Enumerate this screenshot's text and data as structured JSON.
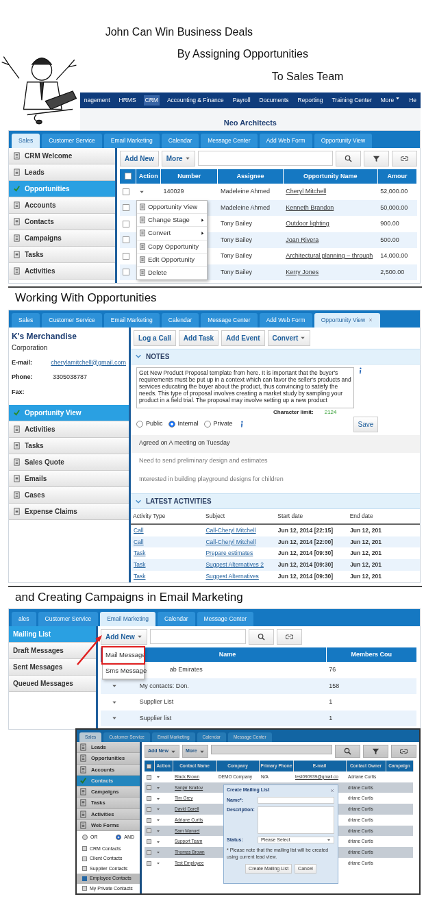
{
  "headlines": [
    "John Can Win Business Deals",
    "By Assigning Opportunities",
    "To Sales Team"
  ],
  "opportunities_screen": {
    "top_menu": [
      {
        "label": "nagement",
        "selected": false,
        "dropdown": false
      },
      {
        "label": "HRMS",
        "selected": false,
        "dropdown": false
      },
      {
        "label": "CRM",
        "selected": true,
        "dropdown": false
      },
      {
        "label": "Accounting & Finance",
        "selected": false,
        "dropdown": false
      },
      {
        "label": "Payroll",
        "selected": false,
        "dropdown": false
      },
      {
        "label": "Documents",
        "selected": false,
        "dropdown": false
      },
      {
        "label": "Reporting",
        "selected": false,
        "dropdown": false
      },
      {
        "label": "Training Center",
        "selected": false,
        "dropdown": false
      },
      {
        "label": "More",
        "selected": false,
        "dropdown": true
      },
      {
        "label": "He",
        "selected": false,
        "dropdown": false
      }
    ],
    "company": "Neo Architects",
    "tabs": [
      {
        "label": "Sales",
        "selected": true
      },
      {
        "label": "Customer Service",
        "selected": false
      },
      {
        "label": "Email Marketing",
        "selected": false
      },
      {
        "label": "Calendar",
        "selected": false
      },
      {
        "label": "Message Center",
        "selected": false
      },
      {
        "label": "Add Web Form",
        "selected": false
      },
      {
        "label": "Opportunity View",
        "selected": false
      }
    ],
    "sidebar": [
      {
        "label": "CRM Welcome",
        "selected": false
      },
      {
        "label": "Leads",
        "selected": false
      },
      {
        "label": "Opportunities",
        "selected": true
      },
      {
        "label": "Accounts",
        "selected": false
      },
      {
        "label": "Contacts",
        "selected": false
      },
      {
        "label": "Campaigns",
        "selected": false
      },
      {
        "label": "Tasks",
        "selected": false
      },
      {
        "label": "Activities",
        "selected": false
      }
    ],
    "toolbar": [
      "Add New",
      "More"
    ],
    "select_all_checked": false,
    "columns": [
      "Action",
      "Number",
      "Assignee",
      "Opportunity Name",
      "Amour"
    ],
    "rows": [
      {
        "checked": false,
        "number": "140029",
        "assignee": "Madeleine Ahmed",
        "opportunity": "Cheryl Mitchell",
        "amount": "52,000.00"
      },
      {
        "checked": false,
        "assignee": "Madeleine Ahmed",
        "opportunity": "Kenneth Brandon",
        "amount": "50,000.00"
      },
      {
        "checked": false,
        "assignee": "Tony Bailey",
        "opportunity": "Outdoor lighting",
        "amount": "900.00"
      },
      {
        "checked": false,
        "assignee": "Tony Bailey",
        "opportunity": "Joan Rivera",
        "amount": "500.00"
      },
      {
        "checked": false,
        "assignee": "Tony Bailey",
        "opportunity": "Architectural planning – through",
        "amount": "14,000.00"
      },
      {
        "checked": false,
        "assignee": "Tony Bailey",
        "opportunity": "Kerry Jones",
        "amount": "2,500.00"
      }
    ],
    "context_menu": [
      {
        "label": "Opportunity View",
        "submenu": false
      },
      {
        "label": "Change Stage",
        "submenu": true
      },
      {
        "label": "Convert",
        "submenu": true
      },
      {
        "label": "Copy Opportunity",
        "submenu": false
      },
      {
        "label": "Edit Opportunity",
        "submenu": false
      },
      {
        "label": "Delete",
        "submenu": false
      }
    ]
  },
  "section_title_2": "Working With Opportunities",
  "opportunity_view": {
    "tabs": [
      {
        "label": "Sales",
        "selected": false
      },
      {
        "label": "Customer Service",
        "selected": false
      },
      {
        "label": "Email Marketing",
        "selected": false
      },
      {
        "label": "Calendar",
        "selected": false
      },
      {
        "label": "Message Center",
        "selected": false
      },
      {
        "label": "Add Web Form",
        "selected": false
      },
      {
        "label": "Opportunity View",
        "selected": true,
        "closable": true
      }
    ],
    "account": {
      "name": "K's Merchandise",
      "type": "Corporation",
      "fields": [
        {
          "label": "E-mail:",
          "value": "cherylamitchell@gmail.com",
          "kind": "link"
        },
        {
          "label": "Phone:",
          "value": "3305038787",
          "kind": "text"
        },
        {
          "label": "Fax:"
        }
      ]
    },
    "sidebar": [
      {
        "label": "Opportunity View",
        "selected": true
      },
      {
        "label": "Activities",
        "selected": false
      },
      {
        "label": "Tasks",
        "selected": false
      },
      {
        "label": "Sales Quote",
        "selected": false
      },
      {
        "label": "Emails",
        "selected": false
      },
      {
        "label": "Cases",
        "selected": false
      },
      {
        "label": "Expense Claims",
        "selected": false
      }
    ],
    "actions": [
      {
        "label": "Log a Call",
        "dropdown": false
      },
      {
        "label": "Add Task",
        "dropdown": false
      },
      {
        "label": "Add Event",
        "dropdown": false
      },
      {
        "label": "Convert",
        "dropdown": true
      }
    ],
    "notes": {
      "title": "NOTES",
      "text": "Get New Product Proposal template from here. It is important that the buyer's requirements must be put up in a context which can favor the seller's products and services educating the buyer about the product, thus convincing to satisfy the needs. This type of proposal involves creating a market study by sampling your product in a field trial. The proposal may involve setting up a new product",
      "char_limit_label": "Character limit:",
      "char_limit": "2124",
      "visibility": [
        {
          "label": "Public",
          "selected": false
        },
        {
          "label": "Internal",
          "selected": true
        },
        {
          "label": "Private",
          "selected": false
        }
      ],
      "save": "Save",
      "entries": [
        "Agreed on A meeting on Tuesday",
        "Need to send preliminary design and estimates",
        "Interested in building playground designs for children"
      ]
    },
    "activities": {
      "title": "LATEST ACTIVITIES",
      "columns": [
        "Activity Type",
        "Subject",
        "Start date",
        "End date"
      ],
      "rows": [
        [
          "Call",
          "Call-Cheryl Mitchell",
          "Jun 12, 2014 [22:15]",
          "Jun 12, 201"
        ],
        [
          "Call",
          "Call-Cheryl Mitchell",
          "Jun 12, 2014 [22:00]",
          "Jun 12, 201"
        ],
        [
          "Task",
          "Prepare estimates",
          "Jun 12, 2014 [09:30]",
          "Jun 12, 201"
        ],
        [
          "Task",
          "Suggest Alternatives 2",
          "Jun 12, 2014 [09:30]",
          "Jun 12, 201"
        ],
        [
          "Task",
          "Suggest Alternatives",
          "Jun 12, 2014 [09:30]",
          "Jun 12, 201"
        ]
      ]
    }
  },
  "section_title_3": "and Creating Campaigns in Email Marketing",
  "email_marketing": {
    "tabs": [
      {
        "label": "ales",
        "selected": false
      },
      {
        "label": "Customer Service",
        "selected": false
      },
      {
        "label": "Email Marketing",
        "selected": true
      },
      {
        "label": "Calendar",
        "selected": false
      },
      {
        "label": "Message Center",
        "selected": false
      }
    ],
    "sidebar": [
      {
        "label": "Mailing List",
        "selected": true
      },
      {
        "label": "Draft Messages",
        "selected": false
      },
      {
        "label": "Sent Messages",
        "selected": false
      },
      {
        "label": "Queued Messages",
        "selected": false
      }
    ],
    "add_new": "Add New",
    "add_menu": [
      {
        "label": "Mail Message",
        "highlighted": true
      },
      {
        "label": "Sms Message",
        "highlighted": false
      }
    ],
    "columns": [
      "Name",
      "Members Cou"
    ],
    "rows": [
      {
        "name": "ab Emirates",
        "count": "76"
      },
      {
        "name": "My contacts: Don.",
        "count": "158"
      },
      {
        "name": "Supplier List",
        "count": "1"
      },
      {
        "name": "Supplier list",
        "count": "1"
      }
    ]
  },
  "contacts_screen": {
    "tabs": [
      {
        "label": "Sales",
        "selected": true
      },
      {
        "label": "Customer Service",
        "selected": false
      },
      {
        "label": "Email Marketing",
        "selected": false
      },
      {
        "label": "Calendar",
        "selected": false
      },
      {
        "label": "Message Center",
        "selected": false
      }
    ],
    "sidebar": [
      {
        "label": "Leads",
        "selected": false
      },
      {
        "label": "Opportunities",
        "selected": false
      },
      {
        "label": "Accounts",
        "selected": false
      },
      {
        "label": "Contacts",
        "selected": true
      },
      {
        "label": "Campaigns",
        "selected": false
      },
      {
        "label": "Tasks",
        "selected": false
      },
      {
        "label": "Activities",
        "selected": false
      },
      {
        "label": "Web Forms",
        "selected": false
      }
    ],
    "filter_mode": [
      {
        "label": "OR",
        "selected": false
      },
      {
        "label": "AND",
        "selected": true
      }
    ],
    "filters": [
      {
        "label": "CRM Contacts",
        "checked": false
      },
      {
        "label": "Client Contacts",
        "checked": false
      },
      {
        "label": "Supplier Contacts",
        "checked": false
      },
      {
        "label": "Employee Contacts",
        "checked": true
      },
      {
        "label": "My Private Contacts",
        "checked": false
      }
    ],
    "toolbar": [
      "Add New",
      "More"
    ],
    "select_all_checked": false,
    "columns": [
      "Action",
      "Contact Name",
      "Company",
      "Primary Phone",
      "E-mail",
      "Contact Owner",
      "Campaign"
    ],
    "rows": [
      {
        "checked": false,
        "name": "Black Brown",
        "company": "DEMO Company",
        "phone": "N/A",
        "email": "test090939@gmail.co",
        "owner": "Adriane Curtis"
      },
      {
        "checked": false,
        "name": "Sanjar Israilov",
        "owner": "driane Curtis"
      },
      {
        "checked": false,
        "name": "Tim Grey",
        "owner": "driane Curtis"
      },
      {
        "checked": false,
        "name": "David Darell",
        "owner": "driane Curtis"
      },
      {
        "checked": false,
        "name": "Adriane Curtis",
        "owner": "driane Curtis"
      },
      {
        "checked": false,
        "name": "Sam Manuel",
        "owner": "driane Curtis"
      },
      {
        "checked": false,
        "name": "Support Team",
        "owner": "driane Curtis"
      },
      {
        "checked": false,
        "name": "Thomas Brown",
        "owner": "driane Curtis"
      },
      {
        "checked": false,
        "name": "Test Employee",
        "owner": "driane Curtis"
      }
    ],
    "dialog": {
      "title": "Create Mailing List",
      "name_label": "Name*:",
      "description_label": "Description:",
      "status_label": "Status:",
      "status_value": "Please Select",
      "note": "* Please note that the mailing list will be created using current lead view.",
      "buttons": [
        "Create Mailing List",
        "Cancel"
      ]
    }
  }
}
